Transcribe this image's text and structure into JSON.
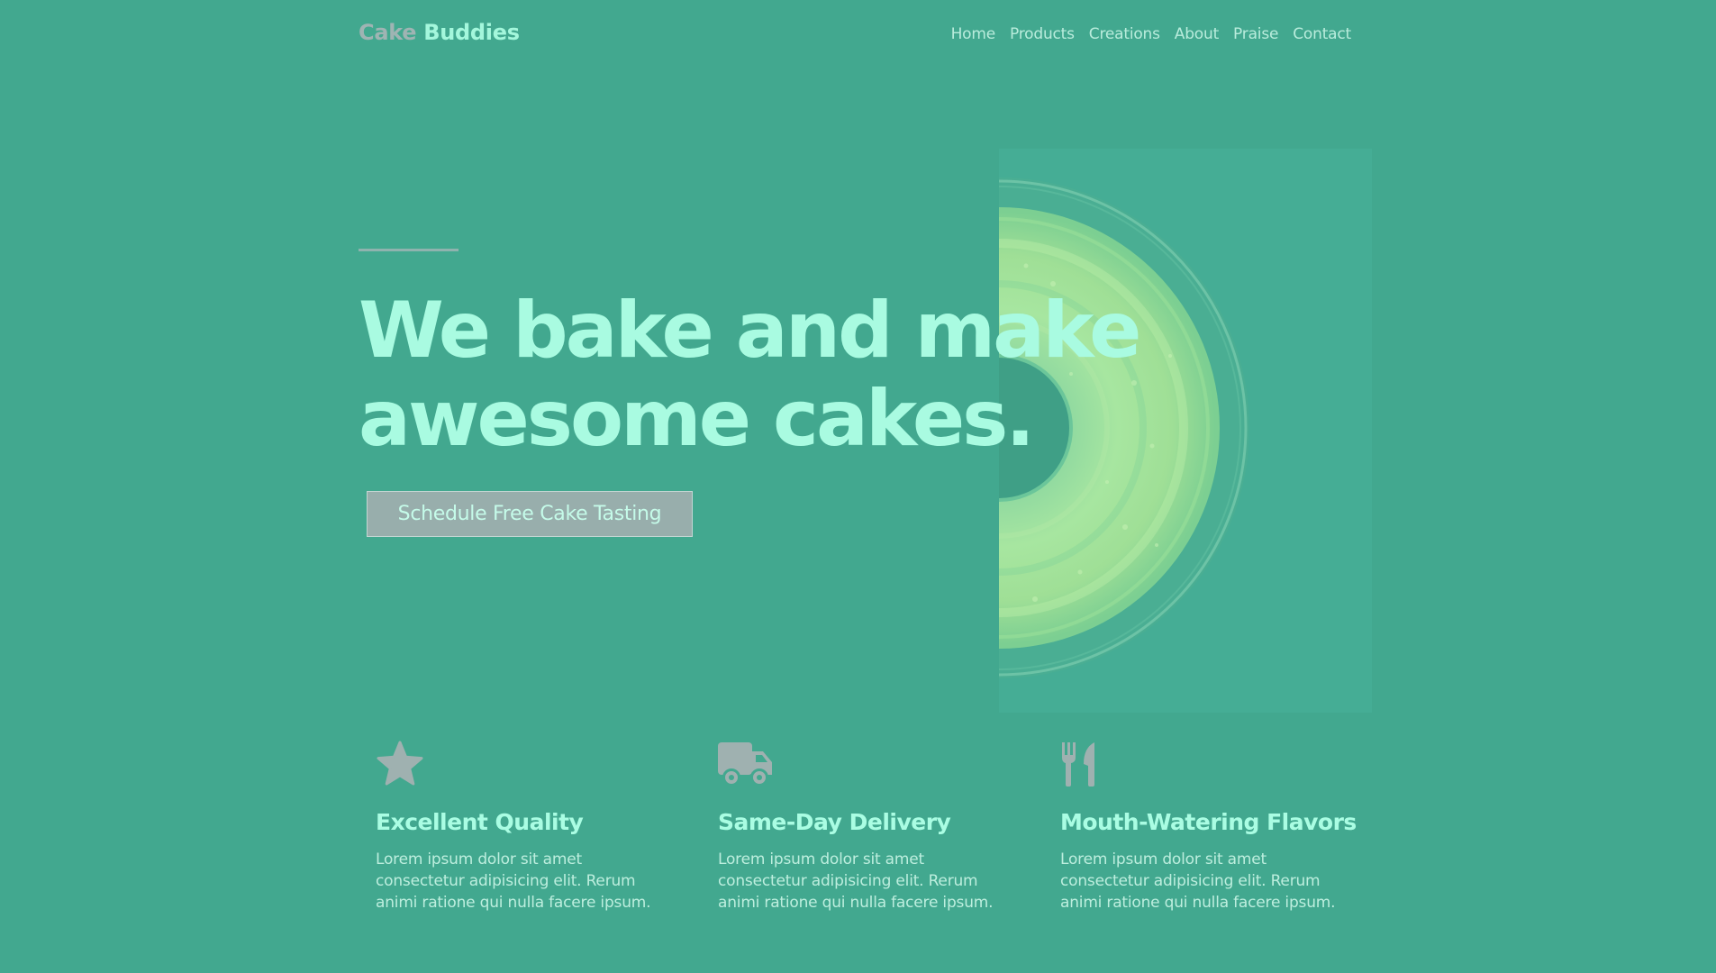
{
  "header": {
    "logo_word1": "Cake",
    "logo_word2": "Buddies",
    "nav": [
      "Home",
      "Products",
      "Creations",
      "About",
      "Praise",
      "Contact"
    ]
  },
  "hero": {
    "headline_line1": "We bake and make",
    "headline_line2": "awesome cakes.",
    "cta_label": "Schedule Free Cake Tasting"
  },
  "features": [
    {
      "icon": "star-icon",
      "title": "Excellent Quality",
      "text": "Lorem ipsum dolor sit amet consectetur adipisicing elit. Rerum animi ratione qui nulla facere ipsum."
    },
    {
      "icon": "truck-icon",
      "title": "Same-Day Delivery",
      "text": "Lorem ipsum dolor sit amet consectetur adipisicing elit. Rerum animi ratione qui nulla facere ipsum."
    },
    {
      "icon": "utensils-icon",
      "title": "Mouth-Watering Flavors",
      "text": "Lorem ipsum dolor sit amet consectetur adipisicing elit. Rerum animi ratione qui nulla facere ipsum."
    }
  ],
  "colors": {
    "background": "#42a88f",
    "headline": "#a9fbe1",
    "logo_muted": "#9fb4b3",
    "button": "#98aeac",
    "icon": "#9fb1b0"
  }
}
